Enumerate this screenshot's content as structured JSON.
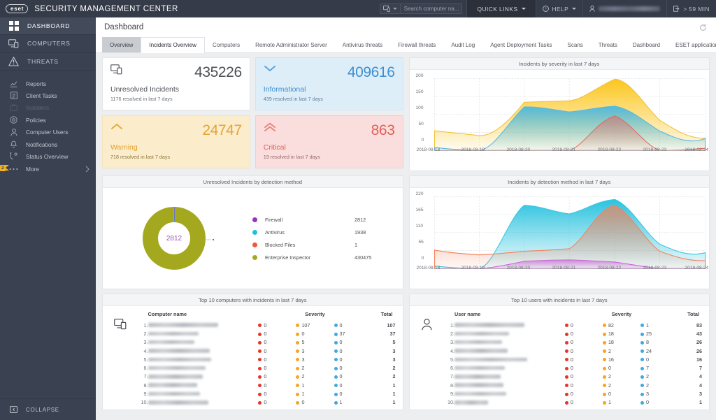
{
  "app": {
    "logo_text": "eset",
    "title": "SECURITY MANAGEMENT CENTER"
  },
  "topbar": {
    "search_placeholder": "Search computer na...",
    "quick_links": "QUICK LINKS",
    "help": "HELP",
    "user_redacted": true,
    "session_timer": "> 59 MIN",
    "icons": [
      "computer-search-icon",
      "chevron-down-icon",
      "help-circle-icon",
      "user-icon",
      "logout-icon"
    ]
  },
  "sidebar": {
    "main_items": [
      {
        "label": "DASHBOARD",
        "icon": "grid-icon",
        "active": true
      },
      {
        "label": "COMPUTERS",
        "icon": "monitor-icon",
        "active": false
      },
      {
        "label": "THREATS",
        "icon": "warning-triangle-icon",
        "active": false
      }
    ],
    "sub_items": [
      {
        "label": "Reports",
        "icon": "chart-icon",
        "disabled": false
      },
      {
        "label": "Client Tasks",
        "icon": "task-icon",
        "disabled": false
      },
      {
        "label": "Installers",
        "icon": "installer-icon",
        "disabled": true
      },
      {
        "label": "Policies",
        "icon": "policy-icon",
        "disabled": false
      },
      {
        "label": "Computer Users",
        "icon": "user-icon",
        "disabled": false
      },
      {
        "label": "Notifications",
        "icon": "bell-icon",
        "disabled": false
      },
      {
        "label": "Status Overview",
        "icon": "status-icon",
        "disabled": false
      },
      {
        "label": "More",
        "icon": "ellipsis-icon",
        "disabled": false
      }
    ],
    "more_badge": "2",
    "collapse_label": "COLLAPSE"
  },
  "page": {
    "title": "Dashboard",
    "refresh_icon": "refresh-icon"
  },
  "tabs": [
    {
      "label": "Overview",
      "state": "selected"
    },
    {
      "label": "Incidents Overview",
      "state": "active"
    },
    {
      "label": "Computers",
      "state": "normal"
    },
    {
      "label": "Remote Administrator Server",
      "state": "normal"
    },
    {
      "label": "Antivirus threats",
      "state": "normal"
    },
    {
      "label": "Firewall threats",
      "state": "normal"
    },
    {
      "label": "Audit Log",
      "state": "normal"
    },
    {
      "label": "Agent Deployment Tasks",
      "state": "normal"
    },
    {
      "label": "Scans",
      "state": "normal"
    },
    {
      "label": "Threats",
      "state": "normal"
    },
    {
      "label": "Dashboard",
      "state": "normal"
    },
    {
      "label": "ESET applications",
      "state": "normal"
    }
  ],
  "tab_add_label": "+",
  "kpis": [
    {
      "key": "unresolved",
      "value": "435226",
      "label": "Unresolved Incidents",
      "sub": "1176 resolved in last 7 days",
      "icon": "monitor-icon",
      "color": "#4e5157"
    },
    {
      "key": "informational",
      "value": "409616",
      "label": "Informational",
      "sub": "439 resolved in last 7 days",
      "icon": "chevron-down-icon",
      "color": "#3f8fd0"
    },
    {
      "key": "warning",
      "value": "24747",
      "label": "Warning",
      "sub": "718 resolved in last 7 days",
      "icon": "chevron-up-icon",
      "color": "#e6a532"
    },
    {
      "key": "critical",
      "value": "863",
      "label": "Critical",
      "sub": "19 resolved in last 7 days",
      "icon": "double-chevron-up-icon",
      "color": "#e36058"
    }
  ],
  "panels": {
    "severity_chart_title": "Incidents by severity in last 7 days",
    "donut_title": "Unresolved Incidents by detection method",
    "detection_chart_title": "Incidents by detection method in last 7 days",
    "computers_table_title": "Top 10 computers with incidents in last 7 days",
    "users_table_title": "Top 10 users with incidents in last 7 days"
  },
  "donut": {
    "center_value": "2812",
    "legend": [
      {
        "name": "Firewall",
        "value": "2812",
        "color": "#9b30c4"
      },
      {
        "name": "Antivirus",
        "value": "1938",
        "color": "#1fc0dd"
      },
      {
        "name": "Blocked Files",
        "value": "1",
        "color": "#f4563c"
      },
      {
        "name": "Enterprise Inspector",
        "value": "430475",
        "color": "#a4a81e"
      }
    ]
  },
  "tables": {
    "computers": {
      "icon": "monitor-icon",
      "headers": {
        "name": "Computer name",
        "severity": "Severity",
        "total": "Total"
      },
      "rows": [
        {
          "rank": "1.",
          "name": "",
          "redacted": true,
          "crit": "0",
          "warn": "107",
          "info": "0",
          "total": "107"
        },
        {
          "rank": "2.",
          "name": "",
          "redacted": true,
          "crit": "0",
          "warn": "0",
          "info": "37",
          "total": "37"
        },
        {
          "rank": "3.",
          "name": "",
          "redacted": true,
          "crit": "0",
          "warn": "5",
          "info": "0",
          "total": "5"
        },
        {
          "rank": "4.",
          "name": "",
          "redacted": true,
          "crit": "0",
          "warn": "3",
          "info": "0",
          "total": "3"
        },
        {
          "rank": "5.",
          "name": "",
          "redacted": true,
          "crit": "0",
          "warn": "3",
          "info": "0",
          "total": "3"
        },
        {
          "rank": "6.",
          "name": "",
          "redacted": true,
          "crit": "0",
          "warn": "2",
          "info": "0",
          "total": "2"
        },
        {
          "rank": "7.",
          "name": "",
          "redacted": true,
          "crit": "0",
          "warn": "2",
          "info": "0",
          "total": "2"
        },
        {
          "rank": "8.",
          "name": "",
          "redacted": true,
          "crit": "0",
          "warn": "1",
          "info": "0",
          "total": "1"
        },
        {
          "rank": "9.",
          "name": "",
          "redacted": true,
          "crit": "0",
          "warn": "1",
          "info": "0",
          "total": "1"
        },
        {
          "rank": "10.",
          "name": "",
          "redacted": true,
          "crit": "0",
          "warn": "0",
          "info": "1",
          "total": "1"
        }
      ]
    },
    "users": {
      "icon": "user-icon",
      "headers": {
        "name": "User name",
        "severity": "Severity",
        "total": "Total"
      },
      "rows": [
        {
          "rank": "1.",
          "name": "",
          "redacted": true,
          "crit": "0",
          "warn": "82",
          "info": "1",
          "total": "83"
        },
        {
          "rank": "2.",
          "name": "",
          "redacted": true,
          "crit": "0",
          "warn": "18",
          "info": "25",
          "total": "43"
        },
        {
          "rank": "3.",
          "name": "",
          "redacted": true,
          "crit": "0",
          "warn": "18",
          "info": "8",
          "total": "26"
        },
        {
          "rank": "4.",
          "name": "",
          "redacted": true,
          "crit": "0",
          "warn": "2",
          "info": "24",
          "total": "26"
        },
        {
          "rank": "5.",
          "name": "",
          "redacted": true,
          "crit": "0",
          "warn": "16",
          "info": "0",
          "total": "16"
        },
        {
          "rank": "6.",
          "name": "",
          "redacted": true,
          "crit": "0",
          "warn": "0",
          "info": "7",
          "total": "7"
        },
        {
          "rank": "7.",
          "name": "",
          "redacted": true,
          "crit": "0",
          "warn": "2",
          "info": "2",
          "total": "4"
        },
        {
          "rank": "8.",
          "name": "",
          "redacted": true,
          "crit": "0",
          "warn": "2",
          "info": "2",
          "total": "4"
        },
        {
          "rank": "9.",
          "name": "",
          "redacted": true,
          "crit": "0",
          "warn": "0",
          "info": "3",
          "total": "3"
        },
        {
          "rank": "10.",
          "name": "",
          "redacted": true,
          "crit": "0",
          "warn": "1",
          "info": "0",
          "total": "1"
        }
      ]
    },
    "severity_colors": {
      "critical": "#e8342a",
      "warning": "#f5a623",
      "informational": "#3fa9e0"
    }
  },
  "chart_data": [
    {
      "id": "incidents-by-severity",
      "type": "area",
      "title": "Incidents by severity in last 7 days",
      "xlabel": "",
      "ylabel": "",
      "grid": true,
      "legend_position": "none",
      "x": [
        "2018-08-18",
        "2018-08-19",
        "2018-08-20",
        "2018-08-21",
        "2018-08-22",
        "2018-08-23",
        "2018-08-24"
      ],
      "xticks": [
        "2018-08-18",
        "2018-08-19",
        "2018-08-20",
        "2018-08-21",
        "2018-08-22",
        "2018-08-23",
        "2018-08-24"
      ],
      "yticks": [
        0,
        50,
        100,
        150,
        200
      ],
      "ylim": [
        0,
        200
      ],
      "stacked": true,
      "series": [
        {
          "name": "Informational",
          "color": "#3fa9e0",
          "values": [
            8,
            0,
            121,
            107,
            123,
            78,
            34
          ]
        },
        {
          "name": "Warning",
          "color": "#f5c23a",
          "values": [
            47,
            41,
            16,
            37,
            75,
            46,
            4
          ]
        },
        {
          "name": "Critical",
          "color": "#e36058",
          "values": [
            0,
            0,
            0,
            0,
            96,
            0,
            6
          ]
        }
      ]
    },
    {
      "id": "incidents-by-detection-method",
      "type": "area",
      "title": "Incidents by detection method in last 7 days",
      "xlabel": "",
      "ylabel": "",
      "grid": true,
      "legend_position": "none",
      "x": [
        "2018-08-18",
        "2018-08-19",
        "2018-08-20",
        "2018-08-21",
        "2018-08-22",
        "2018-08-23",
        "2018-08-24"
      ],
      "xticks": [
        "2018-08-18",
        "2018-08-19",
        "2018-08-20",
        "2018-08-21",
        "2018-08-22",
        "2018-08-23",
        "2018-08-24"
      ],
      "yticks": [
        0,
        55,
        110,
        165,
        220
      ],
      "ylim": [
        0,
        220
      ],
      "stacked": false,
      "series": [
        {
          "name": "Antivirus",
          "color": "#1fc0dd",
          "values": [
            7,
            0,
            196,
            170,
            211,
            110,
            40
          ]
        },
        {
          "name": "Blocked Files",
          "color": "#f4835c",
          "values": [
            53,
            40,
            46,
            58,
            188,
            85,
            23
          ]
        },
        {
          "name": "Firewall",
          "color": "#c964d8",
          "values": [
            0,
            0,
            12,
            20,
            17,
            6,
            0
          ]
        }
      ]
    }
  ]
}
